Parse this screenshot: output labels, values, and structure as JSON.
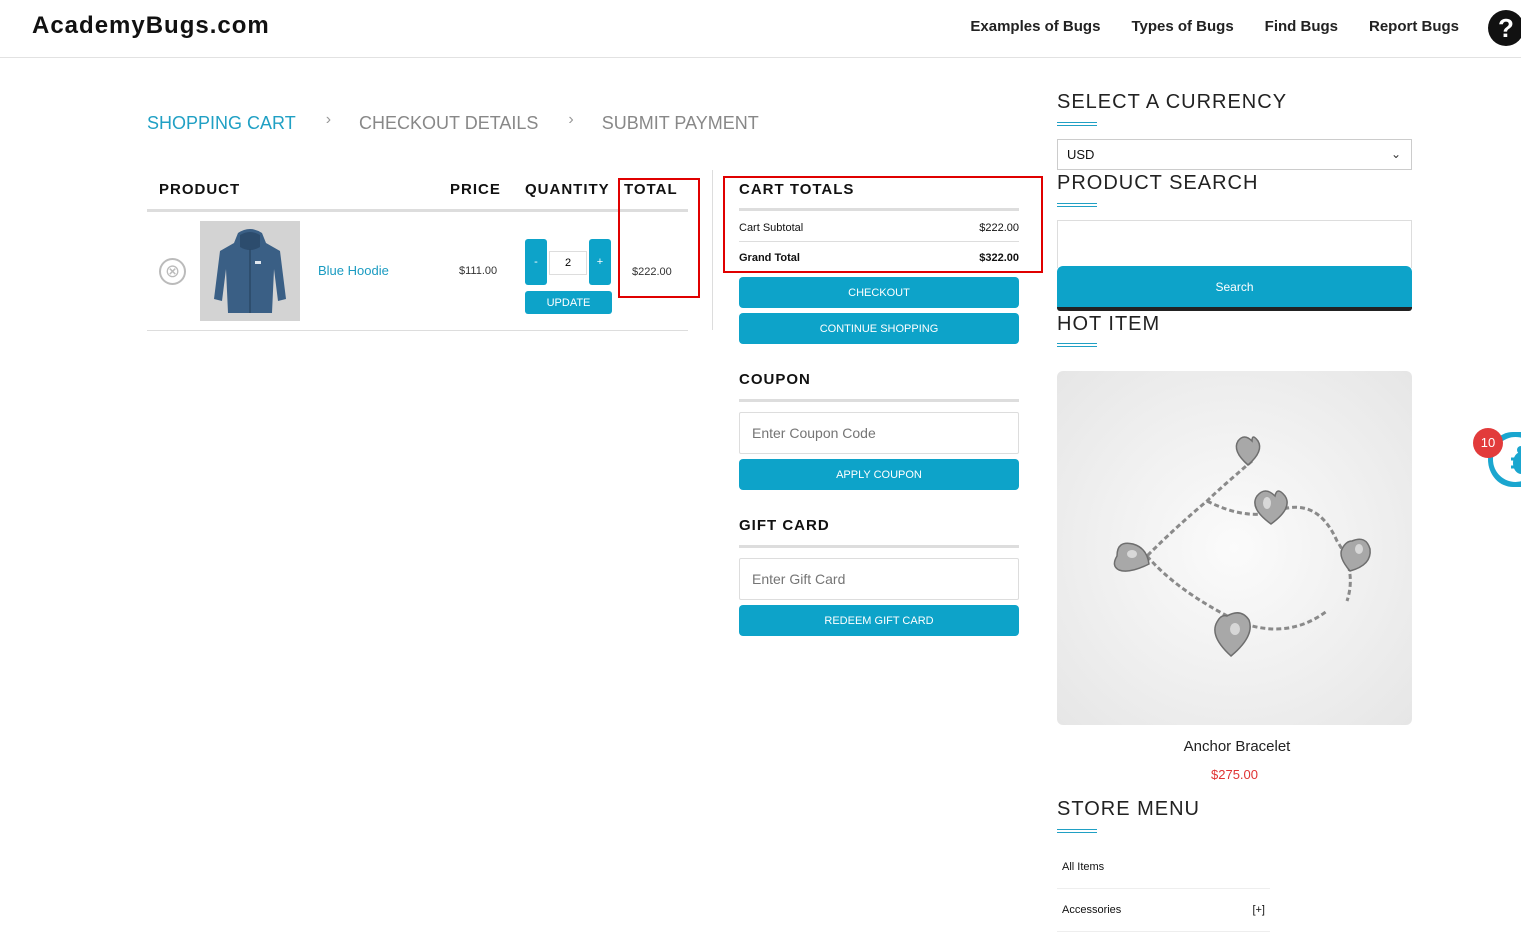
{
  "header": {
    "logo": "AcademyBugs.com",
    "nav": [
      "Examples of Bugs",
      "Types of Bugs",
      "Find Bugs",
      "Report Bugs"
    ],
    "help_icon": "?"
  },
  "steps": {
    "items": [
      "SHOPPING CART",
      "CHECKOUT DETAILS",
      "SUBMIT PAYMENT"
    ],
    "active": "SHOPPING CART",
    "separator": "›"
  },
  "cart": {
    "columns": {
      "product": "PRODUCT",
      "price": "PRICE",
      "quantity": "QUANTITY",
      "total": "TOTAL"
    },
    "items": [
      {
        "name": "Blue Hoodie",
        "price": "$111.00",
        "quantity": "2",
        "total": "$222.00",
        "remove_icon": "⊗",
        "minus": "-",
        "plus": "+",
        "update": "UPDATE"
      }
    ]
  },
  "totals": {
    "title": "CART TOTALS",
    "subtotal_label": "Cart Subtotal",
    "subtotal_value": "$222.00",
    "grand_label": "Grand Total",
    "grand_value": "$322.00",
    "checkout": "CHECKOUT",
    "continue": "CONTINUE SHOPPING"
  },
  "coupon": {
    "title": "COUPON",
    "placeholder": "Enter Coupon Code",
    "button": "APPLY COUPON"
  },
  "gift_card": {
    "title": "GIFT CARD",
    "placeholder": "Enter Gift Card",
    "button": "REDEEM GIFT CARD"
  },
  "sidebar": {
    "currency_title": "SELECT A CURRENCY",
    "currency_value": "USD",
    "search_title": "PRODUCT SEARCH",
    "search_button": "Search",
    "hot_title": "HOT ITEM",
    "hot_item": {
      "name": "Anchor Bracelet",
      "price": "$275.00"
    },
    "menu_title": "STORE MENU",
    "menu_items": [
      {
        "label": "All Items",
        "expander": ""
      },
      {
        "label": "Accessories",
        "expander": "[+]"
      }
    ]
  },
  "bug_widget": {
    "count": "10"
  },
  "colors": {
    "accent": "#0da3c9",
    "highlight": "#e00000",
    "price_red": "#e03333"
  }
}
